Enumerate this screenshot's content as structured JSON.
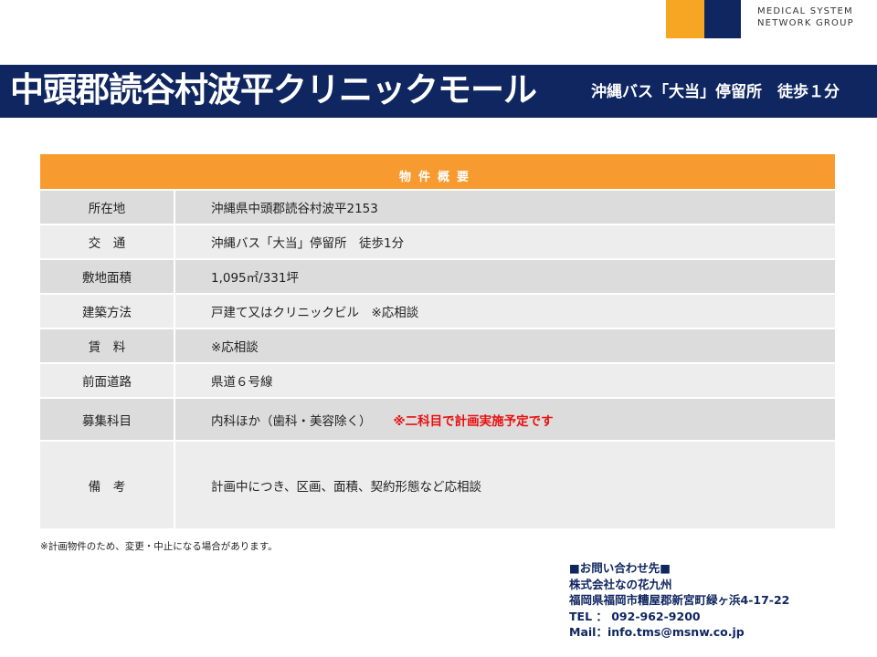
{
  "logo": {
    "line1": "MEDICAL SYSTEM",
    "line2": "NETWORK GROUP",
    "color_orange": "#f6a623",
    "color_navy": "#0f2660"
  },
  "header": {
    "title": "中頭郡読谷村波平クリニックモール",
    "access": "沖縄バス「大当」停留所　徒歩１分"
  },
  "table": {
    "heading": "物件概要",
    "rows": [
      {
        "label": "所在地",
        "value": "沖縄県中頭郡読谷村波平2153"
      },
      {
        "label": "交　通",
        "value": "沖縄バス「大当」停留所　徒歩1分"
      },
      {
        "label": "敷地面積",
        "value": "1,095㎡/331坪"
      },
      {
        "label": "建築方法",
        "value": "戸建て又はクリニックビル　※応相談"
      },
      {
        "label": "賃　料",
        "value": "※応相談"
      },
      {
        "label": "前面道路",
        "value": "県道６号線"
      },
      {
        "label": "募集科目",
        "value": "内科ほか（歯科・美容除く）",
        "note": "※二科目で計画実施予定です"
      },
      {
        "label": "備　考",
        "value": "計画中につき、区画、面積、契約形態など応相談"
      }
    ]
  },
  "footnote": "※計画物件のため、変更・中止になる場合があります。",
  "contact": {
    "heading": "■お問い合わせ先■",
    "company": "株式会社なの花九州",
    "address": "福岡県福岡市糟屋郡新宮町緑ヶ浜4-17-22",
    "tel": "TEL ： 092-962-9200",
    "mail": "Mail：info.tms@msnw.co.jp"
  }
}
